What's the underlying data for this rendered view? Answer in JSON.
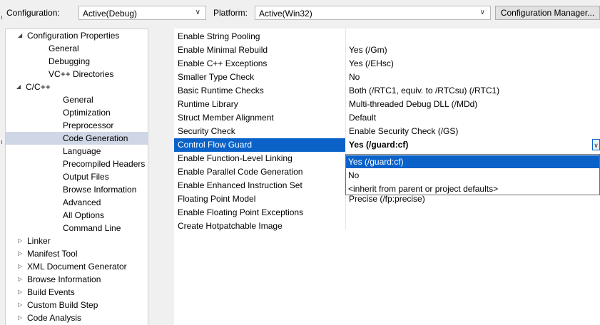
{
  "toolbar": {
    "configuration_label": "Configuration:",
    "configuration_value": "Active(Debug)",
    "platform_label": "Platform:",
    "platform_value": "Active(Win32)",
    "config_manager_button": "Configuration Manager..."
  },
  "tree": {
    "items": [
      {
        "label": "Configuration Properties",
        "expander": "expanded"
      },
      {
        "label": "General"
      },
      {
        "label": "Debugging"
      },
      {
        "label": "VC++ Directories"
      },
      {
        "label": "C/C++",
        "expander": "expanded"
      },
      {
        "label": "General"
      },
      {
        "label": "Optimization"
      },
      {
        "label": "Preprocessor"
      },
      {
        "label": "Code Generation",
        "selected": true
      },
      {
        "label": "Language"
      },
      {
        "label": "Precompiled Headers"
      },
      {
        "label": "Output Files"
      },
      {
        "label": "Browse Information"
      },
      {
        "label": "Advanced"
      },
      {
        "label": "All Options"
      },
      {
        "label": "Command Line"
      },
      {
        "label": "Linker",
        "expander": "collapsed"
      },
      {
        "label": "Manifest Tool",
        "expander": "collapsed"
      },
      {
        "label": "XML Document Generator",
        "expander": "collapsed"
      },
      {
        "label": "Browse Information",
        "expander": "collapsed"
      },
      {
        "label": "Build Events",
        "expander": "collapsed"
      },
      {
        "label": "Custom Build Step",
        "expander": "collapsed"
      },
      {
        "label": "Code Analysis",
        "expander": "collapsed"
      }
    ]
  },
  "properties": [
    {
      "name": "Enable String Pooling",
      "value": ""
    },
    {
      "name": "Enable Minimal Rebuild",
      "value": "Yes (/Gm)"
    },
    {
      "name": "Enable C++ Exceptions",
      "value": "Yes (/EHsc)"
    },
    {
      "name": "Smaller Type Check",
      "value": "No"
    },
    {
      "name": "Basic Runtime Checks",
      "value": "Both (/RTC1, equiv. to /RTCsu) (/RTC1)"
    },
    {
      "name": "Runtime Library",
      "value": "Multi-threaded Debug DLL (/MDd)"
    },
    {
      "name": "Struct Member Alignment",
      "value": "Default"
    },
    {
      "name": "Security Check",
      "value": "Enable Security Check (/GS)"
    },
    {
      "name": "Control Flow Guard",
      "value": "Yes (/guard:cf)",
      "selected": true
    },
    {
      "name": "Enable Function-Level Linking",
      "value": ""
    },
    {
      "name": "Enable Parallel Code Generation",
      "value": ""
    },
    {
      "name": "Enable Enhanced Instruction Set",
      "value": ""
    },
    {
      "name": "Floating Point Model",
      "value": "Precise (/fp:precise)"
    },
    {
      "name": "Enable Floating Point Exceptions",
      "value": ""
    },
    {
      "name": "Create Hotpatchable Image",
      "value": ""
    }
  ],
  "dropdown": {
    "options": [
      "Yes (/guard:cf)",
      "No",
      "<inherit from parent or project defaults>"
    ],
    "highlighted_index": 0
  },
  "icons": {
    "expanded": "triangle-down-icon",
    "collapsed": "triangle-right-icon",
    "combo": "chevron-down-icon"
  },
  "colors": {
    "selection_blue": "#0a62c9",
    "tree_selection": "#cfd6e5",
    "window_bg": "#f0f0f0"
  }
}
